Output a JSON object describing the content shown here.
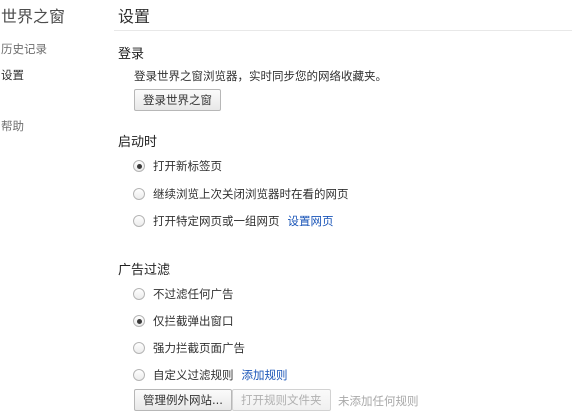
{
  "sidebar": {
    "app_title": "世界之窗",
    "items": [
      {
        "label": "历史记录"
      },
      {
        "label": "设置"
      },
      {
        "label": "帮助"
      }
    ]
  },
  "header": {
    "title": "设置"
  },
  "login": {
    "title": "登录",
    "description": "登录世界之窗浏览器，实时同步您的网络收藏夹。",
    "button_label": "登录世界之窗"
  },
  "startup": {
    "title": "启动时",
    "options": [
      {
        "label": "打开新标签页",
        "checked": true
      },
      {
        "label": "继续浏览上次关闭浏览器时在看的网页",
        "checked": false
      },
      {
        "label": "打开特定网页或一组网页",
        "checked": false
      }
    ],
    "set_pages_link": "设置网页"
  },
  "adfilter": {
    "title": "广告过滤",
    "options": [
      {
        "label": "不过滤任何广告",
        "checked": false
      },
      {
        "label": "仅拦截弹出窗口",
        "checked": true
      },
      {
        "label": "强力拦截页面广告",
        "checked": false
      },
      {
        "label": "自定义过滤规则",
        "checked": false
      }
    ],
    "add_rule_link": "添加规则",
    "manage_exceptions_button": "管理例外网站...",
    "open_rules_folder_button": "打开规则文件夹",
    "no_rules_text": "未添加任何规则"
  }
}
